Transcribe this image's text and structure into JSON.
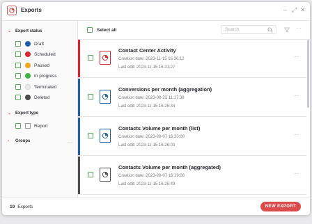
{
  "window": {
    "title": "Exports",
    "controls": {
      "minimize": "–",
      "maximize": "⤢",
      "close": "✕"
    }
  },
  "sidebar": {
    "export_status": {
      "heading": "Export status",
      "items": [
        {
          "label": "Draft",
          "color": "#1f5fa8"
        },
        {
          "label": "Scheduled",
          "color": "#d6262f"
        },
        {
          "label": "Paused",
          "color": "#f0a81e"
        },
        {
          "label": "In progress",
          "color": "#3fb249"
        },
        {
          "label": "Terminated",
          "color": "#ececee"
        },
        {
          "label": "Deleted",
          "color": "#4a4a4f"
        }
      ]
    },
    "export_type": {
      "heading": "Export type",
      "items": [
        {
          "label": "Report"
        }
      ]
    },
    "groups": {
      "heading": "Groups",
      "more": "···"
    }
  },
  "toolbar": {
    "select_all": "Select all",
    "search_placeholder": "Search",
    "more": "···"
  },
  "exports": [
    {
      "title": "Contact Center Activity",
      "created": "Creation date: 2023-11-15 16:30:12",
      "edited": "Last edit: 2023-11-15 16:31:27",
      "status_color": "#d6262f",
      "more": "···"
    },
    {
      "title": "Conversions per month (aggregation)",
      "created": "Creation date: 2023-08-22 11:17:38",
      "edited": "Last edit: 2023-11-15 16:26:34",
      "status_color": "#1f5fa8",
      "more": "···"
    },
    {
      "title": "Contacts Volume per month (list)",
      "created": "Creation date: 2023-09-07 16:20:00",
      "edited": "Last edit: 2023-11-15 16:26:03",
      "status_color": "#1f5fa8",
      "more": "···"
    },
    {
      "title": "Contacts Volume per month (aggregated)",
      "created": "Creation date: 2023-09-07 16:19:06",
      "edited": "Last edit: 2023-11-15 16:25:49",
      "status_color": "#4a4a4f",
      "more": "···"
    }
  ],
  "footer": {
    "count": "19",
    "count_label": "Exports",
    "new_export": "NEW EXPORT"
  },
  "colors": {
    "accent": "#dc4b4b",
    "checkbox": "#5aa85f"
  }
}
